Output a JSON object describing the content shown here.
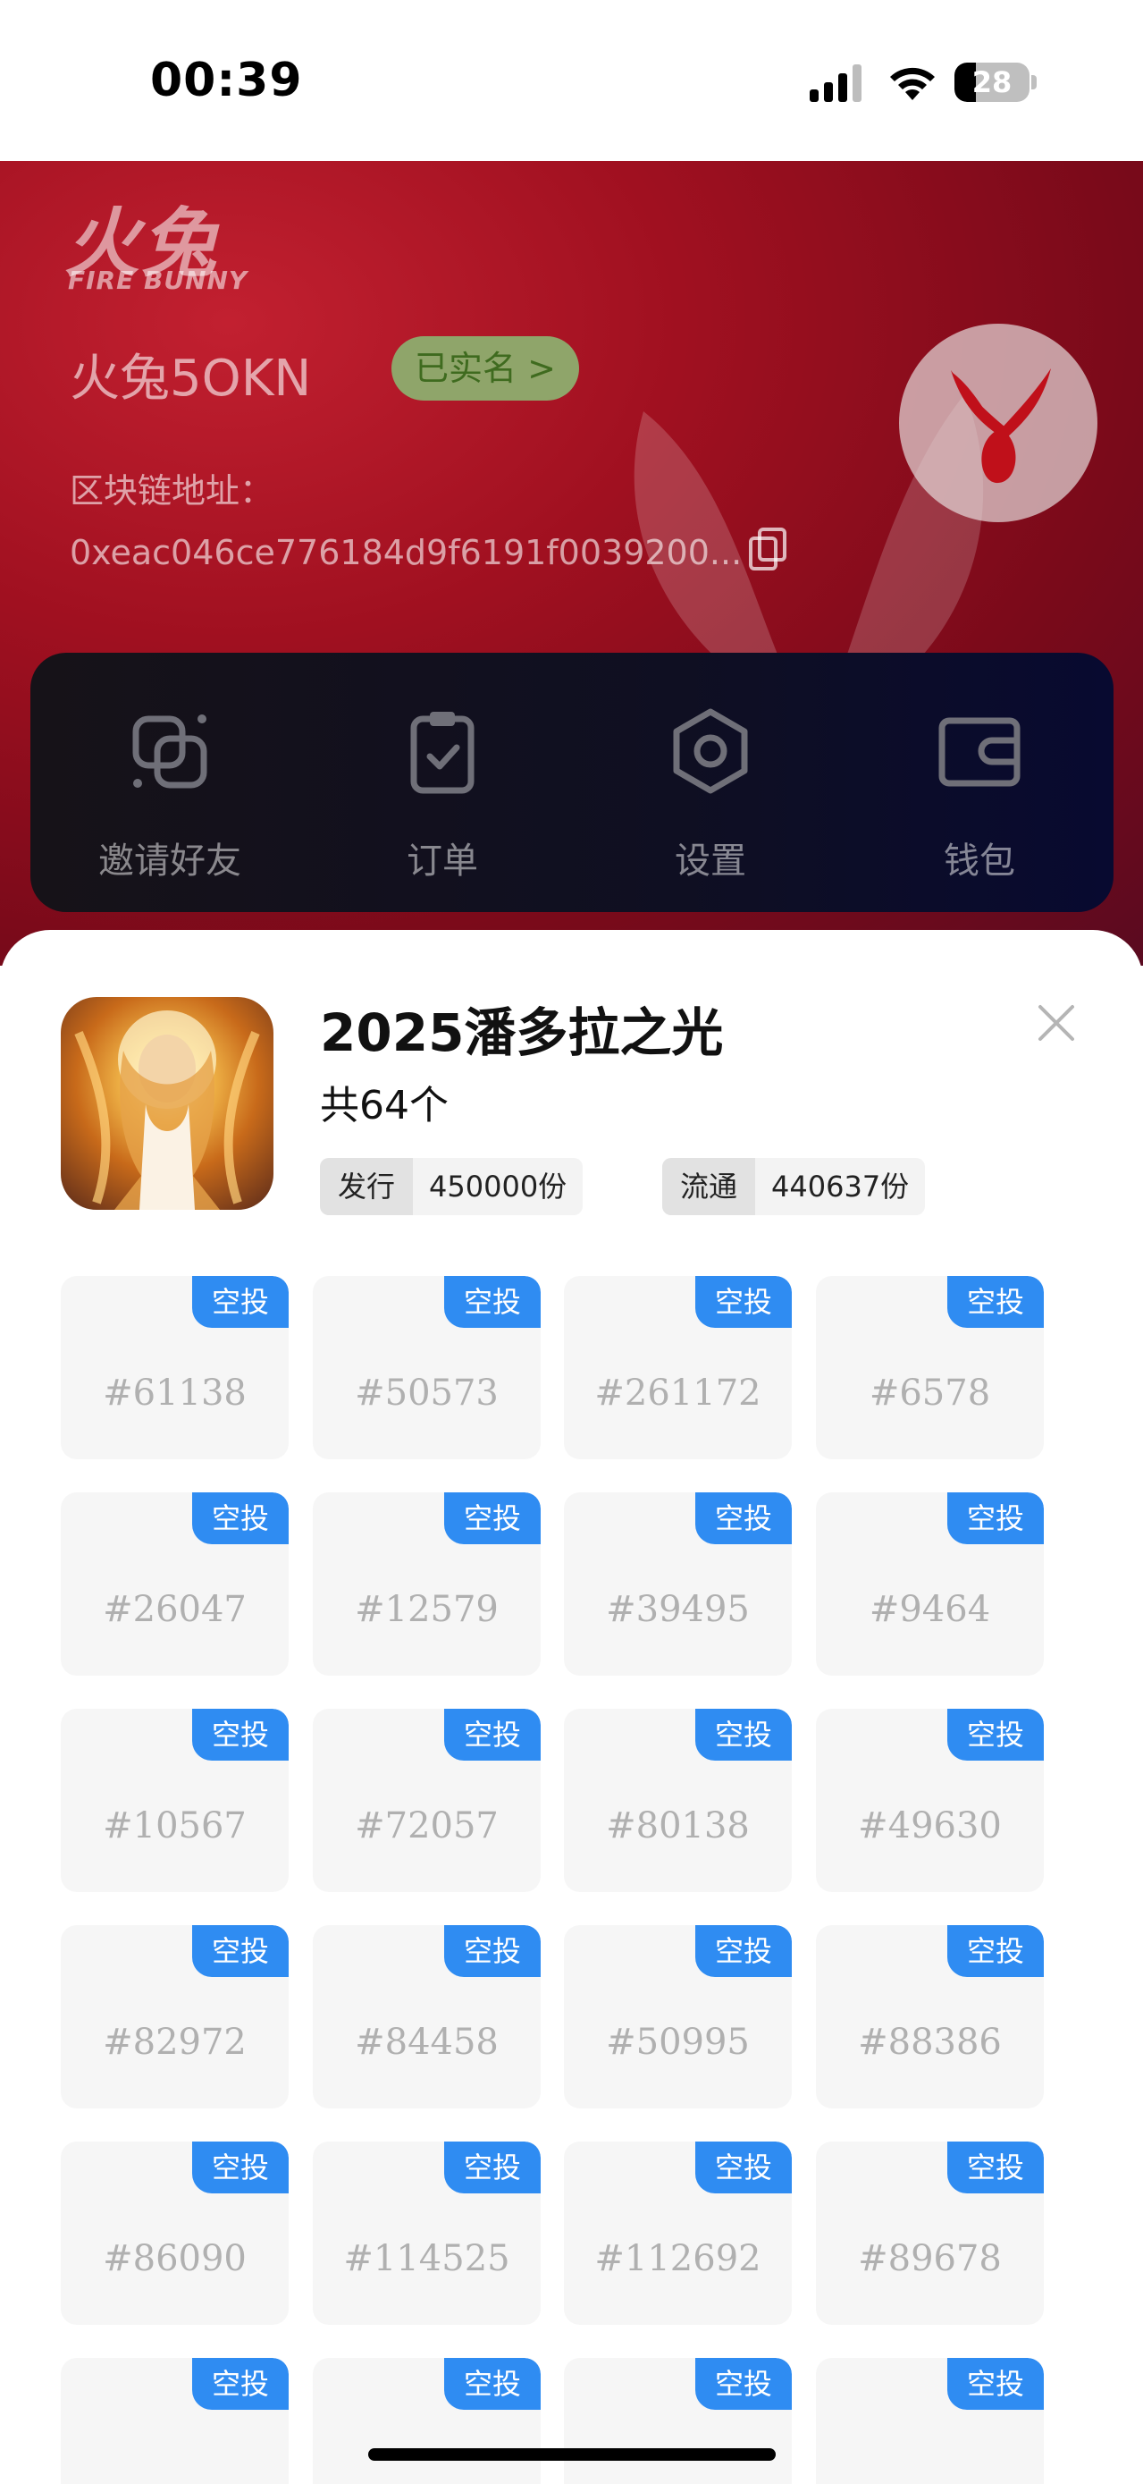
{
  "status_bar": {
    "time": "00:39",
    "battery": "28",
    "battery_level": 0.28
  },
  "header": {
    "logo_cn": "火兔",
    "logo_en": "FIRE BUNNY",
    "username": "火兔5OKN",
    "verified_badge": "已实名 >",
    "address_label": "区块链地址：",
    "address_value": "0xeac046ce776184d9f6191f0039200..."
  },
  "menu": {
    "items": [
      {
        "label": "邀请好友",
        "icon": "invite-icon"
      },
      {
        "label": "订单",
        "icon": "clipboard-icon"
      },
      {
        "label": "设置",
        "icon": "settings-icon"
      },
      {
        "label": "钱包",
        "icon": "wallet-icon"
      }
    ]
  },
  "sheet": {
    "title": "2025潘多拉之光",
    "count": "共64个",
    "issue_label": "发行",
    "issue_value": "450000份",
    "circulation_label": "流通",
    "circulation_value": "440637份",
    "badge_label": "空投",
    "items": [
      "#61138",
      "#50573",
      "#261172",
      "#6578",
      "#26047",
      "#12579",
      "#39495",
      "#9464",
      "#10567",
      "#72057",
      "#80138",
      "#49630",
      "#82972",
      "#84458",
      "#50995",
      "#88386",
      "#86090",
      "#114525",
      "#112692",
      "#89678",
      "",
      "",
      "",
      ""
    ]
  },
  "colors": {
    "header_red": "#a01020",
    "badge_blue": "#2f8cf2",
    "verified_green": "#8fa56a"
  }
}
